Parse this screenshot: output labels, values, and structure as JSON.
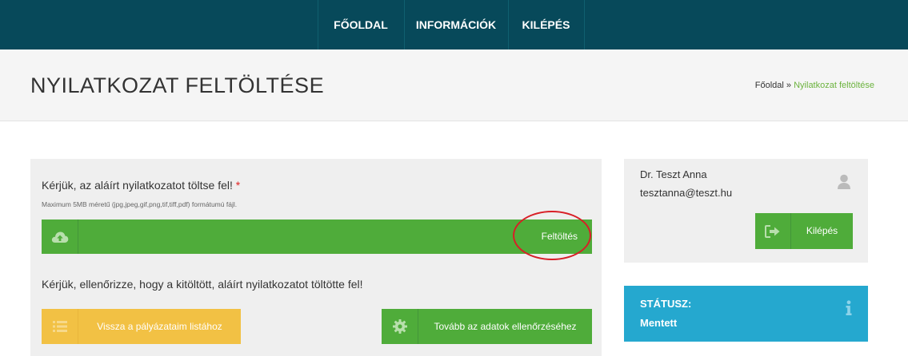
{
  "nav": {
    "items": [
      {
        "label": "FŐOLDAL"
      },
      {
        "label": "INFORMÁCIÓK"
      },
      {
        "label": "KILÉPÉS"
      }
    ]
  },
  "header": {
    "title": "NYILATKOZAT FELTÖLTÉSE",
    "breadcrumb": {
      "home": "Főoldal",
      "separator": "»",
      "current": "Nyilatkozat feltöltése"
    }
  },
  "upload": {
    "label": "Kérjük, az aláírt nyilatkozatot töltse fel!",
    "required_mark": "*",
    "help": "Maximum 5MB méretű (jpg,jpeg,gif,png,tif,tiff,pdf) formátumú fájl.",
    "button_label": "Feltöltés",
    "icon": "cloud-upload-icon"
  },
  "check_text": "Kérjük, ellenőrizze, hogy a kitöltött, aláírt nyilatkozatot töltötte fel!",
  "actions": {
    "back_label": "Vissza a pályázataim listához",
    "back_icon": "list-icon",
    "next_label": "Tovább az adatok ellenőrzéséhez",
    "next_icon": "gear-icon"
  },
  "user": {
    "name": "Dr. Teszt Anna",
    "email": "tesztanna@teszt.hu",
    "logout_label": "Kilépés",
    "icon": "user-icon"
  },
  "status": {
    "title": "STÁTUSZ:",
    "value": "Mentett",
    "icon": "info-icon"
  },
  "colors": {
    "nav_bg": "#07495a",
    "green": "#4fac3a",
    "yellow": "#f2c144",
    "blue": "#25a8cf",
    "highlight_circle": "#d81f27"
  }
}
